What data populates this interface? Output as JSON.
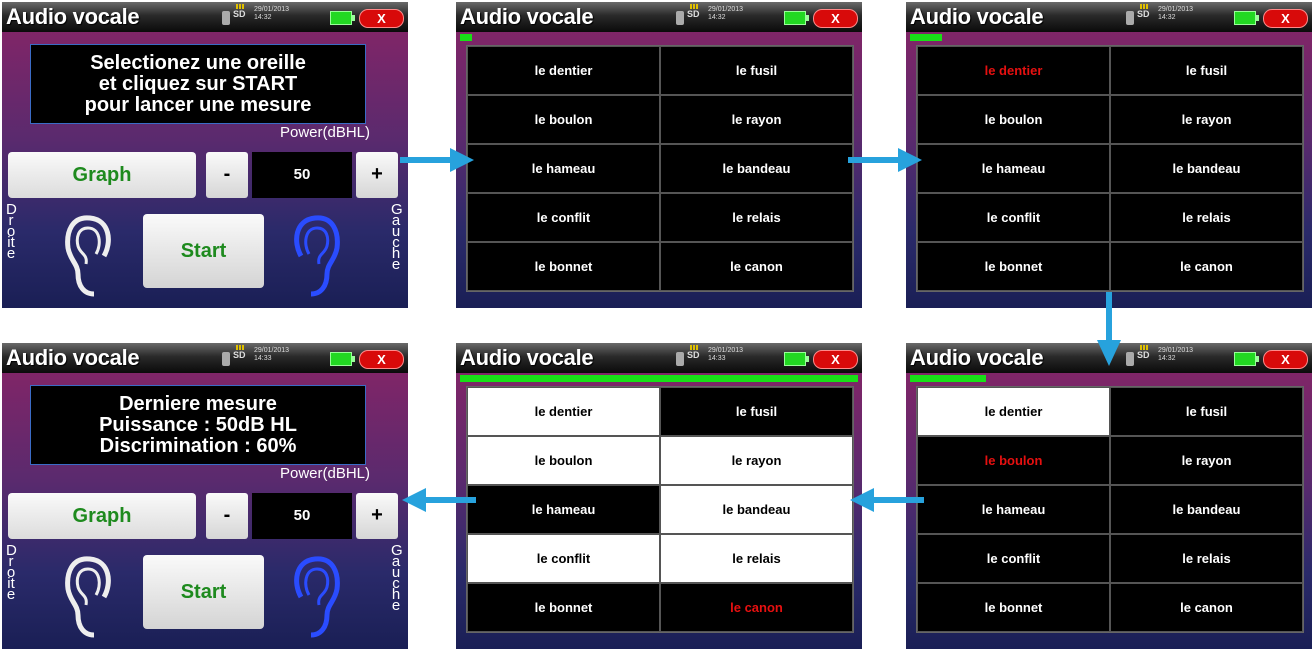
{
  "screens": {
    "s1": {
      "title": "Audio vocale",
      "sd": "SD",
      "date": "29/01/2013",
      "time": "14:32",
      "close": "X",
      "message": [
        "Selectionez une oreille",
        "et cliquez sur START",
        "pour lancer une mesure"
      ],
      "power_label": "Power(dBHL)",
      "graph": "Graph",
      "minus": "-",
      "value": "50",
      "plus": "+",
      "start": "Start",
      "left_ear": "Droite",
      "right_ear": "Gauche"
    },
    "s2": {
      "title": "Audio vocale",
      "sd": "SD",
      "date": "29/01/2013",
      "time": "14:32",
      "close": "X",
      "progress": 0.03,
      "cells": [
        "le dentier",
        "le fusil",
        "le boulon",
        "le rayon",
        "le hameau",
        "le bandeau",
        "le conflit",
        "le relais",
        "le bonnet",
        "le canon"
      ]
    },
    "s3": {
      "title": "Audio vocale",
      "sd": "SD",
      "date": "29/01/2013",
      "time": "14:32",
      "close": "X",
      "progress": 0.08,
      "cells": [
        "le dentier",
        "le fusil",
        "le boulon",
        "le rayon",
        "le hameau",
        "le bandeau",
        "le conflit",
        "le relais",
        "le bonnet",
        "le canon"
      ]
    },
    "s4": {
      "title": "Audio vocale",
      "sd": "SD",
      "date": "29/01/2013",
      "time": "14:33",
      "close": "X",
      "message": [
        "Derniere mesure",
        "Puissance : 50dB HL",
        "Discrimination : 60%"
      ],
      "power_label": "Power(dBHL)",
      "graph": "Graph",
      "minus": "-",
      "value": "50",
      "plus": "+",
      "start": "Start",
      "left_ear": "Droite",
      "right_ear": "Gauche"
    },
    "s5": {
      "title": "Audio vocale",
      "sd": "SD",
      "date": "29/01/2013",
      "time": "14:33",
      "close": "X",
      "progress": 1.0,
      "cells": [
        "le dentier",
        "le fusil",
        "le boulon",
        "le rayon",
        "le hameau",
        "le bandeau",
        "le conflit",
        "le relais",
        "le bonnet",
        "le canon"
      ]
    },
    "s6": {
      "title": "Audio vocale",
      "sd": "SD",
      "date": "29/01/2013",
      "time": "14:32",
      "close": "X",
      "progress": 0.19,
      "cells": [
        "le dentier",
        "le fusil",
        "le boulon",
        "le rayon",
        "le hameau",
        "le bandeau",
        "le conflit",
        "le relais",
        "le bonnet",
        "le canon"
      ]
    }
  },
  "colors": {
    "progress": "#18e018",
    "highlight_text": "#e61010",
    "graph_text": "#1e8a1e",
    "arrow": "#27a2dd"
  }
}
